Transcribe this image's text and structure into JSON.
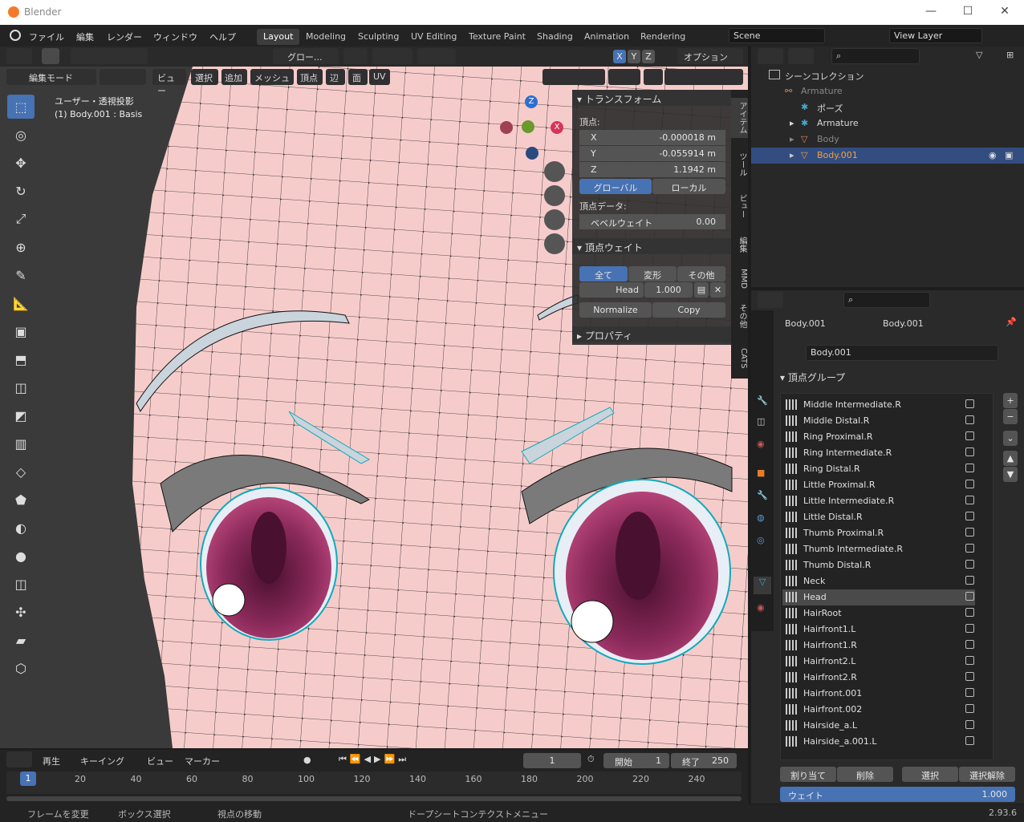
{
  "window": {
    "title": "Blender",
    "minimize": "—",
    "maximize": "☐",
    "close": "✕"
  },
  "menu": [
    "ファイル",
    "編集",
    "レンダー",
    "ウィンドウ",
    "ヘルプ"
  ],
  "workspaces": [
    "Layout",
    "Modeling",
    "Sculpting",
    "UV Editing",
    "Texture Paint",
    "Shading",
    "Animation",
    "Rendering"
  ],
  "active_workspace": "Layout",
  "scene": {
    "value": "Scene",
    "view_layer": "View Layer"
  },
  "header": {
    "transform_orient": "グロー...",
    "axes": [
      "X",
      "Y",
      "Z"
    ],
    "options": "オプション",
    "mode": "編集モード",
    "view": "ビュー",
    "select": "選択",
    "add": "追加",
    "mesh": "メッシュ",
    "vertex": "頂点",
    "edge": "辺",
    "face": "面",
    "uv": "UV"
  },
  "viewport": {
    "line1": "ユーザー・透視投影",
    "line2": "(1) Body.001 : Basis"
  },
  "gizmo": {
    "x": "X",
    "y": "Y",
    "z": "Z"
  },
  "npanel": {
    "transform_title": "トランスフォーム",
    "vertex_label": "頂点:",
    "x_label": "X",
    "x_value": "-0.000018 m",
    "y_label": "Y",
    "y_value": "-0.055914 m",
    "z_label": "Z",
    "z_value": "1.1942 m",
    "global": "グローバル",
    "local": "ローカル",
    "vertex_data": "頂点データ:",
    "bevel_label": "ベベルウェイト",
    "bevel_value": "0.00",
    "weight_title": "頂点ウェイト",
    "all": "全て",
    "deform": "変形",
    "other": "その他",
    "head_label": "Head",
    "head_value": "1.000",
    "normalize": "Normalize",
    "copy": "Copy",
    "properties_title": "プロパティ"
  },
  "vtabs": [
    "アイテム",
    "ツール",
    "ビュー",
    "編集",
    "MMD",
    "その他",
    "CATS"
  ],
  "outliner": {
    "collection": "シーンコレクション",
    "rows": [
      {
        "label": "Armature",
        "dim": true
      },
      {
        "label": "ポーズ",
        "dim": false
      },
      {
        "label": "Armature",
        "dim": false
      },
      {
        "label": "Body",
        "dim": true
      },
      {
        "label": "Body.001",
        "dim": false,
        "selected": true
      }
    ]
  },
  "props": {
    "object": "Body.001",
    "data": "Body.001",
    "mesh_name": "Body.001",
    "section": "頂点グループ",
    "groups": [
      "Middle Intermediate.R",
      "Middle Distal.R",
      "Ring Proximal.R",
      "Ring Intermediate.R",
      "Ring Distal.R",
      "Little Proximal.R",
      "Little Intermediate.R",
      "Little Distal.R",
      "Thumb Proximal.R",
      "Thumb Intermediate.R",
      "Thumb Distal.R",
      "Neck",
      "Head",
      "HairRoot",
      "Hairfront1.L",
      "Hairfront1.R",
      "Hairfront2.L",
      "Hairfront2.R",
      "Hairfront.001",
      "Hairfront.002",
      "Hairside_a.L",
      "Hairside_a.001.L"
    ],
    "active_group": "Head",
    "assign": "割り当て",
    "remove": "削除",
    "select": "選択",
    "deselect": "選択解除",
    "weight_label": "ウェイト",
    "weight_value": "1.000"
  },
  "timeline": {
    "play": "再生",
    "keying": "キーイング",
    "view": "ビュー",
    "marker": "マーカー",
    "current": "1",
    "start_label": "開始",
    "start": "1",
    "end_label": "終了",
    "end": "250",
    "ticks": [
      "20",
      "40",
      "60",
      "80",
      "100",
      "120",
      "140",
      "160",
      "180",
      "200",
      "220",
      "240"
    ],
    "frame_badge": "1"
  },
  "status": {
    "a": "フレームを変更",
    "b": "ボックス選択",
    "c": "視点の移動",
    "d": "ドープシートコンテクストメニュー",
    "version": "2.93.6"
  }
}
